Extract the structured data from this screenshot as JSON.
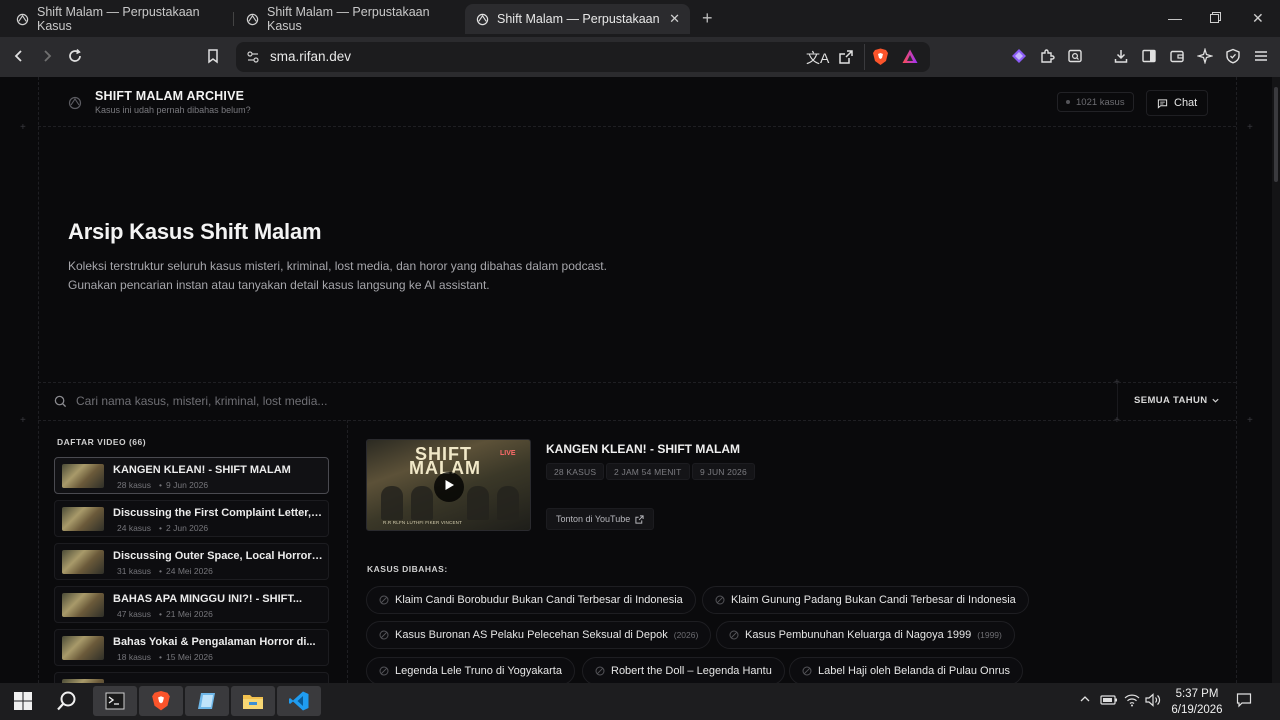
{
  "browser": {
    "tabs": [
      {
        "title": "Shift Malam — Perpustakaan Kasus",
        "active": false
      },
      {
        "title": "Shift Malam — Perpustakaan Kasus",
        "active": false
      },
      {
        "title": "Shift Malam — Perpustakaan Kasus",
        "active": true
      }
    ],
    "new_tab_label": "+",
    "url": "sma.rifan.dev"
  },
  "header": {
    "brand_title": "SHIFT MALAM ARCHIVE",
    "brand_subtitle": "Kasus ini udah pernah dibahas belum?",
    "case_count": "1021 kasus",
    "chat_label": "Chat"
  },
  "hero": {
    "title": "Arsip Kasus Shift Malam",
    "description_line1": "Koleksi terstruktur seluruh kasus misteri, kriminal, lost media, dan horor yang dibahas dalam podcast.",
    "description_line2": "Gunakan pencarian instan atau tanyakan detail kasus langsung ke AI assistant."
  },
  "search": {
    "placeholder": "Cari nama kasus, misteri, kriminal, lost media...",
    "year_filter": "SEMUA TAHUN"
  },
  "video_list": {
    "title": "DAFTAR VIDEO (66)",
    "items": [
      {
        "title": "KANGEN KLEAN! - SHIFT MALAM",
        "cases": "28 kasus",
        "date": "9 Jun 2026",
        "selected": true
      },
      {
        "title": "Discussing the First Complaint Letter, th...",
        "cases": "24 kasus",
        "date": "2 Jun 2026",
        "selected": false
      },
      {
        "title": "Discussing Outer Space, Local Horror &...",
        "cases": "31 kasus",
        "date": "24 Mei 2026",
        "selected": false
      },
      {
        "title": "BAHAS APA MINGGU INI?! - SHIFT...",
        "cases": "47 kasus",
        "date": "21 Mei 2026",
        "selected": false
      },
      {
        "title": "Bahas Yokai & Pengalaman Horror di...",
        "cases": "18 kasus",
        "date": "15 Mei 2026",
        "selected": false
      }
    ]
  },
  "detail": {
    "title": "KANGEN KLEAN! - SHIFT MALAM",
    "thumb_word1": "SHIFT",
    "thumb_word2": "MALAM",
    "thumb_live": "LIVE",
    "thumb_names": "R.R      RLFN      LUTHFI      FIKER      VINCENT",
    "chips": [
      "28 KASUS",
      "2 JAM 54 MENIT",
      "9 JUN 2026"
    ],
    "youtube_label": "Tonton di YouTube",
    "cases_title": "KASUS DIBAHAS:",
    "cases": [
      {
        "name": "Klaim Candi Borobudur Bukan Candi Terbesar di Indonesia",
        "year": ""
      },
      {
        "name": "Klaim Gunung Padang Bukan Candi Terbesar di Indonesia",
        "year": ""
      },
      {
        "name": "Kasus Buronan AS Pelaku Pelecehan Seksual di Depok",
        "year": "(2026)"
      },
      {
        "name": "Kasus Pembunuhan Keluarga di Nagoya 1999",
        "year": "(1999)"
      },
      {
        "name": "Legenda Lele Truno di Yogyakarta",
        "year": ""
      },
      {
        "name": "Robert the Doll – Legenda Hantu",
        "year": ""
      },
      {
        "name": "Label Haji oleh Belanda di Pulau Onrus",
        "year": ""
      }
    ]
  },
  "taskbar": {
    "time": "5:37 PM",
    "date": "6/19/2026"
  },
  "colors": {
    "page_bg": "#0a0a0c",
    "chrome_bg": "#2b2b2e",
    "accent_brave": "#fb542b",
    "vscode_blue": "#1f9cf0"
  }
}
